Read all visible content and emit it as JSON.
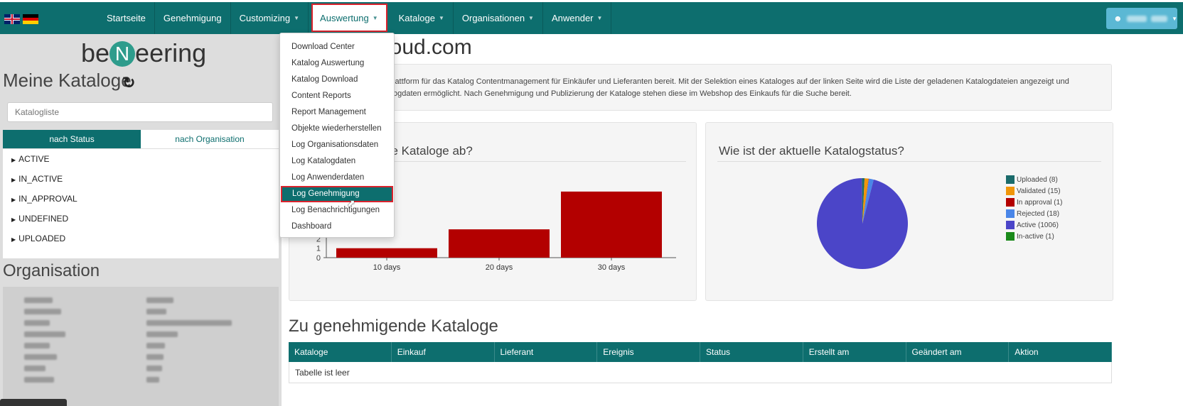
{
  "nav": {
    "items": [
      {
        "label": "Startseite",
        "caret": false
      },
      {
        "label": "Genehmigung",
        "caret": false
      },
      {
        "label": "Customizing",
        "caret": true
      },
      {
        "label": "Auswertung",
        "caret": true,
        "active": true
      },
      {
        "label": "Kataloge",
        "caret": true
      },
      {
        "label": "Organisationen",
        "caret": true
      },
      {
        "label": "Anwender",
        "caret": true
      }
    ],
    "accent": "#0d6e6e",
    "highlight": "#d9232d"
  },
  "dropdown": {
    "items": [
      "Download Center",
      "Katalog Auswertung",
      "Katalog Download",
      "Content Reports",
      "Report Management",
      "Objekte wiederherstellen",
      "Log Organisationsdaten",
      "Log Katalogdaten",
      "Log Anwenderdaten",
      "Log Genehmigung",
      "Log Benachrichtigungen",
      "Dashboard"
    ],
    "selected_index": 9
  },
  "left": {
    "logo_prefix": "be",
    "logo_n": "N",
    "logo_suffix": "eering",
    "title": "Meine Kataloge",
    "search_placeholder": "Katalogliste",
    "tabs": [
      "nach Status",
      "nach Organisation"
    ],
    "tree": [
      "ACTIVE",
      "IN_ACTIVE",
      "IN_APPROVAL",
      "UNDEFINED",
      "UPLOADED"
    ],
    "org_title": "Organisation"
  },
  "main": {
    "title": "loud.com",
    "info_line1": "lattform für das Katalog Contentmanagement für Einkäufer und Lieferanten bereit. Mit der Selektion eines Kataloges auf der linken Seite wird die Liste der geladenen Katalogdateien angezeigt und",
    "info_line2": "ogdaten ermöglicht. Nach Genehmigung und Publizierung der Kataloge stehen diese im Webshop des Einkaufs für die Suche bereit.",
    "card1_title": "ne Kataloge ab?",
    "card2_title": "Wie ist der aktuelle Katalogstatus?",
    "table_title": "Zu genehmigende Kataloge",
    "table_headers": [
      "Kataloge",
      "Einkauf",
      "Lieferant",
      "Ereignis",
      "Status",
      "Erstellt am",
      "Geändert am",
      "Aktion"
    ],
    "table_empty": "Tabelle ist leer"
  },
  "chart_data": [
    {
      "type": "bar",
      "categories": [
        "10 days",
        "20 days",
        "30 days"
      ],
      "values": [
        1,
        3,
        7
      ],
      "visible_yticks": [
        "2",
        "1",
        "0"
      ],
      "color": "#b30000"
    },
    {
      "type": "pie",
      "series": [
        {
          "name": "Uploaded (8)",
          "value": 8,
          "color": "#1a6b6b"
        },
        {
          "name": "Validated (15)",
          "value": 15,
          "color": "#f0960a"
        },
        {
          "name": "In approval (1)",
          "value": 1,
          "color": "#b30000"
        },
        {
          "name": "Rejected (18)",
          "value": 18,
          "color": "#4a86e8"
        },
        {
          "name": "Active (1006)",
          "value": 1006,
          "color": "#4b45c8"
        },
        {
          "name": "In-active (1)",
          "value": 1,
          "color": "#1a8a1a"
        }
      ],
      "legend_position": "right"
    }
  ]
}
